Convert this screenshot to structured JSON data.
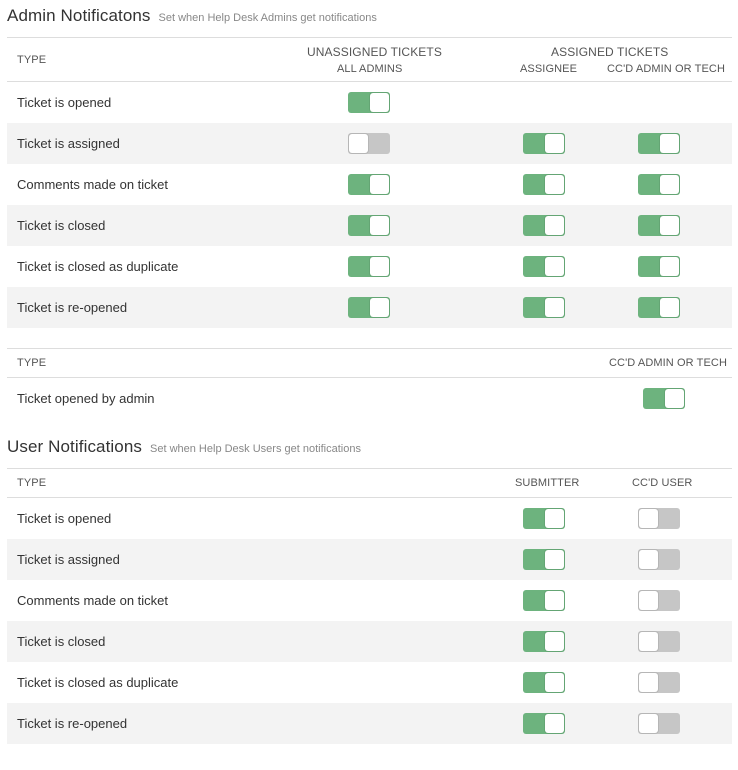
{
  "admin": {
    "title": "Admin Notificatons",
    "subtitle": "Set when Help Desk Admins get notifications",
    "headers": {
      "type": "TYPE",
      "unassigned_group": "UNASSIGNED TICKETS",
      "all_admins": "ALL ADMINS",
      "assigned_group": "ASSIGNED TICKETS",
      "assignee": "ASSIGNEE",
      "ccd": "CC'D ADMIN OR TECH"
    },
    "rows": [
      {
        "label": "Ticket is opened",
        "all_admins": true,
        "assignee": null,
        "ccd": null
      },
      {
        "label": "Ticket is assigned",
        "all_admins": false,
        "assignee": true,
        "ccd": true
      },
      {
        "label": "Comments made on ticket",
        "all_admins": true,
        "assignee": true,
        "ccd": true
      },
      {
        "label": "Ticket is closed",
        "all_admins": true,
        "assignee": true,
        "ccd": true
      },
      {
        "label": "Ticket is closed as duplicate",
        "all_admins": true,
        "assignee": true,
        "ccd": true
      },
      {
        "label": "Ticket is re-opened",
        "all_admins": true,
        "assignee": true,
        "ccd": true
      }
    ],
    "second_table": {
      "type": "TYPE",
      "ccd": "CC'D ADMIN OR TECH",
      "rows": [
        {
          "label": "Ticket opened by admin",
          "ccd": true
        }
      ]
    }
  },
  "user": {
    "title": "User Notifications",
    "subtitle": "Set when Help Desk Users get notifications",
    "headers": {
      "type": "TYPE",
      "submitter": "SUBMITTER",
      "ccd_user": "CC'D USER"
    },
    "rows": [
      {
        "label": "Ticket is opened",
        "submitter": true,
        "ccd_user": false
      },
      {
        "label": "Ticket is assigned",
        "submitter": true,
        "ccd_user": false
      },
      {
        "label": "Comments made on ticket",
        "submitter": true,
        "ccd_user": false
      },
      {
        "label": "Ticket is closed",
        "submitter": true,
        "ccd_user": false
      },
      {
        "label": "Ticket is closed as duplicate",
        "submitter": true,
        "ccd_user": false
      },
      {
        "label": "Ticket is re-opened",
        "submitter": true,
        "ccd_user": false
      }
    ]
  },
  "colors": {
    "toggle_on": "#6db37e",
    "toggle_off": "#c6c6c6",
    "row_alt": "#f3f3f3"
  }
}
